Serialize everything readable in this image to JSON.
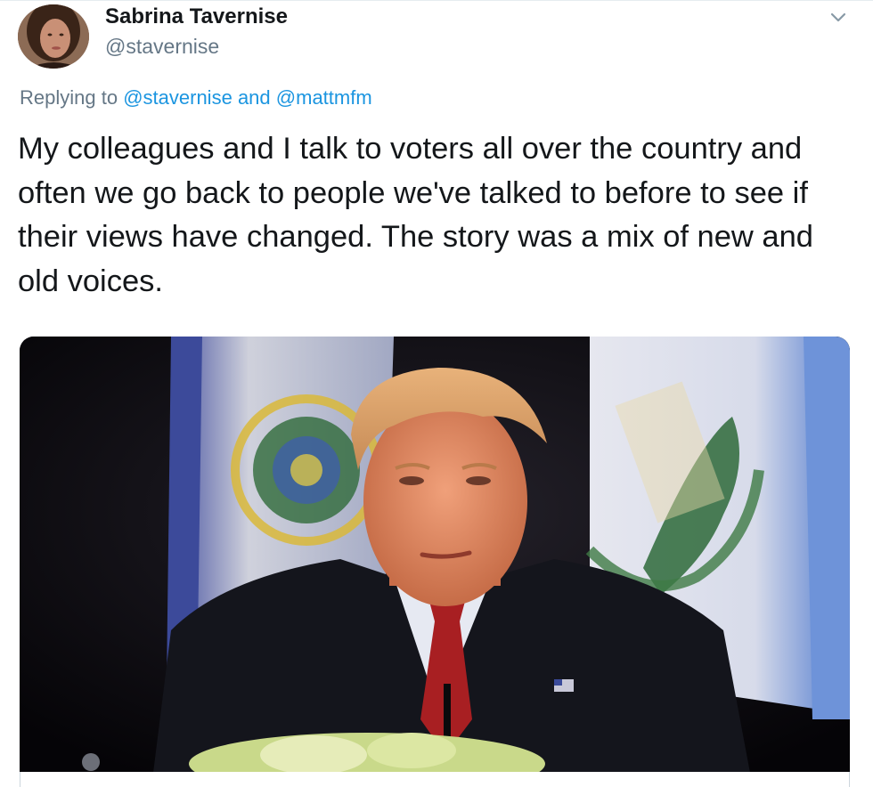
{
  "tweet": {
    "author": {
      "display_name": "Sabrina Tavernise",
      "handle": "@stavernise"
    },
    "replying": {
      "prefix": "Replying to",
      "mention_1": "@stavernise",
      "joiner": "and",
      "mention_2": "@mattmfm"
    },
    "text": "My colleagues and I talk to voters all over the country and often we go back to people we've talked to before to see if their views have changed. The story was a mix of new and old voices.",
    "icons": {
      "menu": "chevron-down-icon"
    },
    "media": {
      "type": "photo"
    }
  }
}
